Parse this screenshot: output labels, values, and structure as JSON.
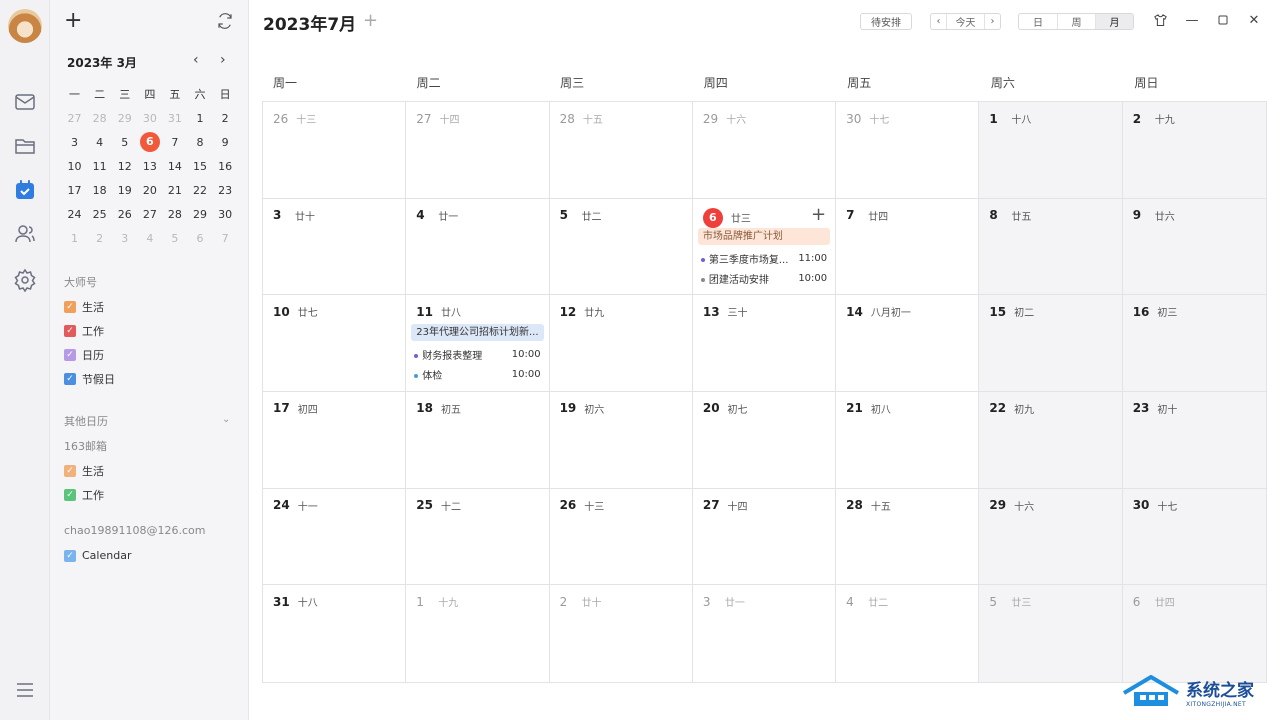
{
  "header": {
    "month_title": "2023年7月",
    "pending_label": "待安排",
    "today_label": "今天",
    "views": [
      "日",
      "周",
      "月"
    ],
    "active_view": "月"
  },
  "mini_calendar": {
    "title": "2023年 3月",
    "weekdays": [
      "一",
      "二",
      "三",
      "四",
      "五",
      "六",
      "日"
    ],
    "weeks": [
      [
        "27",
        "28",
        "29",
        "30",
        "31",
        "1",
        "2"
      ],
      [
        "3",
        "4",
        "5",
        "6",
        "7",
        "8",
        "9"
      ],
      [
        "10",
        "11",
        "12",
        "13",
        "14",
        "15",
        "16"
      ],
      [
        "17",
        "18",
        "19",
        "20",
        "21",
        "22",
        "23"
      ],
      [
        "24",
        "25",
        "26",
        "27",
        "28",
        "29",
        "30"
      ],
      [
        "1",
        "2",
        "3",
        "4",
        "5",
        "6",
        "7"
      ]
    ],
    "today": "6"
  },
  "sidebar": {
    "group1_label": "大师号",
    "group1_items": [
      {
        "label": "生活",
        "color": "#f0a05a"
      },
      {
        "label": "工作",
        "color": "#e25a5a"
      },
      {
        "label": "日历",
        "color": "#b79ae6"
      },
      {
        "label": "节假日",
        "color": "#4a8fe0"
      }
    ],
    "other_label": "其他日历",
    "mail163_label": "163邮箱",
    "mail163_items": [
      {
        "label": "生活",
        "color": "#f0b27a"
      },
      {
        "label": "工作",
        "color": "#5ac47a"
      }
    ],
    "account_label": "chao19891108@126.com",
    "account_items": [
      {
        "label": "Calendar",
        "color": "#7ab4ee"
      }
    ]
  },
  "weekdays": [
    "周一",
    "周二",
    "周三",
    "周四",
    "周五",
    "周六",
    "周日"
  ],
  "calendar": {
    "weeks": [
      [
        {
          "d": "26",
          "l": "十三",
          "o": true
        },
        {
          "d": "27",
          "l": "十四",
          "o": true
        },
        {
          "d": "28",
          "l": "十五",
          "o": true
        },
        {
          "d": "29",
          "l": "十六",
          "o": true
        },
        {
          "d": "30",
          "l": "十七",
          "o": true
        },
        {
          "d": "1",
          "l": "十八"
        },
        {
          "d": "2",
          "l": "十九"
        }
      ],
      [
        {
          "d": "3",
          "l": "廿十"
        },
        {
          "d": "4",
          "l": "廿一"
        },
        {
          "d": "5",
          "l": "廿二"
        },
        {
          "d": "6",
          "l": "廿三",
          "today": true
        },
        {
          "d": "7",
          "l": "廿四"
        },
        {
          "d": "8",
          "l": "廿五"
        },
        {
          "d": "9",
          "l": "廿六"
        }
      ],
      [
        {
          "d": "10",
          "l": "廿七"
        },
        {
          "d": "11",
          "l": "廿八"
        },
        {
          "d": "12",
          "l": "廿九"
        },
        {
          "d": "13",
          "l": "三十"
        },
        {
          "d": "14",
          "l": "八月初一"
        },
        {
          "d": "15",
          "l": "初二"
        },
        {
          "d": "16",
          "l": "初三"
        }
      ],
      [
        {
          "d": "17",
          "l": "初四"
        },
        {
          "d": "18",
          "l": "初五"
        },
        {
          "d": "19",
          "l": "初六"
        },
        {
          "d": "20",
          "l": "初七"
        },
        {
          "d": "21",
          "l": "初八"
        },
        {
          "d": "22",
          "l": "初九"
        },
        {
          "d": "23",
          "l": "初十"
        }
      ],
      [
        {
          "d": "24",
          "l": "十一"
        },
        {
          "d": "25",
          "l": "十二"
        },
        {
          "d": "26",
          "l": "十三"
        },
        {
          "d": "27",
          "l": "十四"
        },
        {
          "d": "28",
          "l": "十五"
        },
        {
          "d": "29",
          "l": "十六"
        },
        {
          "d": "30",
          "l": "十七"
        }
      ],
      [
        {
          "d": "31",
          "l": "十八"
        },
        {
          "d": "1",
          "l": "十九",
          "o": true
        },
        {
          "d": "2",
          "l": "廿十",
          "o": true
        },
        {
          "d": "3",
          "l": "廿一",
          "o": true
        },
        {
          "d": "4",
          "l": "廿二",
          "o": true
        },
        {
          "d": "5",
          "l": "廿三",
          "o": true
        },
        {
          "d": "6",
          "l": "廿四",
          "o": true
        }
      ]
    ],
    "events": [
      {
        "week": 1,
        "day": 3,
        "allday": {
          "title": "市场品牌推广计划",
          "bg": "#fde6d8",
          "fg": "#8a5a3c"
        },
        "items": [
          {
            "title": "第三季度市场复...",
            "time": "11:00",
            "dot": "#7a5ad6"
          },
          {
            "title": "团建活动安排",
            "time": "10:00",
            "dot": "#888888"
          }
        ]
      },
      {
        "week": 2,
        "day": 1,
        "allday": {
          "title": "23年代理公司招标计划新...",
          "bg": "#dce8f8",
          "fg": "#333333"
        },
        "items": [
          {
            "title": "财务报表整理",
            "time": "10:00",
            "dot": "#7a5ad6"
          },
          {
            "title": "体检",
            "time": "10:00",
            "dot": "#4a9ae0"
          }
        ]
      }
    ]
  },
  "watermark": {
    "cn": "系统之家",
    "en": "XITONGZHIJIA.NET"
  }
}
